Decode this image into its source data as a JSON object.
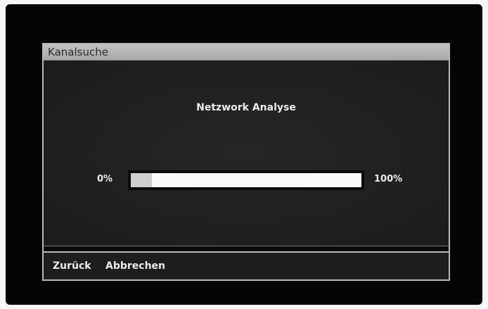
{
  "dialog": {
    "title": "Kanalsuche",
    "heading": "Netzwork Analyse"
  },
  "progress": {
    "min_label": "0%",
    "max_label": "100%",
    "value_percent": 9
  },
  "footer": {
    "back_label": "Zurück",
    "cancel_label": "Abbrechen"
  },
  "colors": {
    "screen_background": "#050505",
    "titlebar": "#b4b4b4",
    "text": "#ececec",
    "bar_track": "#fafafa",
    "bar_fill": "#cfcfcf"
  }
}
